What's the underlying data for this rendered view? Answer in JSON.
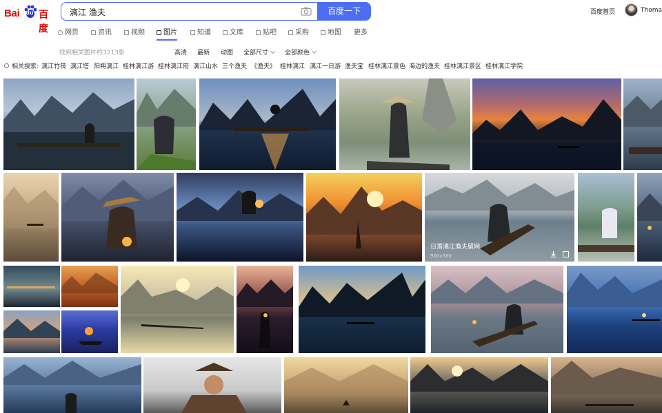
{
  "header": {
    "logo_left": "Bai",
    "logo_mid": "du",
    "logo_right": "百度",
    "search_query": "漓江 渔夫",
    "search_button": "百度一下",
    "home_link": "百度首页",
    "user_name": "Thomas"
  },
  "tabs": [
    {
      "label": "网页",
      "icon": "search-icon"
    },
    {
      "label": "资讯",
      "icon": "news-icon"
    },
    {
      "label": "视频",
      "icon": "video-icon"
    },
    {
      "label": "图片",
      "icon": "image-icon",
      "active": true
    },
    {
      "label": "知道",
      "icon": "question-icon"
    },
    {
      "label": "文库",
      "icon": "document-icon"
    },
    {
      "label": "贴吧",
      "icon": "forum-icon"
    },
    {
      "label": "采购",
      "icon": "shopping-icon"
    },
    {
      "label": "地图",
      "icon": "map-icon"
    },
    {
      "label": "更多",
      "icon": ""
    }
  ],
  "filters": {
    "count_text": "找到相关图片约3213张",
    "items": [
      "高清",
      "最新",
      "动图",
      "全部尺寸",
      "全部颜色"
    ]
  },
  "related": {
    "label": "相关搜索:",
    "items": [
      "漓江竹筏",
      "漓江塔",
      "阳朔漓江",
      "桂林漓江游",
      "桂林漓江府",
      "漓江山水",
      "三个渔夫",
      "《渔夫》",
      "桂林漓江",
      "漓江一日游",
      "渔夫宝",
      "桂林漓江景色",
      "海边的渔夫",
      "桂林漓江景区",
      "桂林漓江学院"
    ]
  },
  "hover_card": {
    "caption": "日落漓江渔夫留网",
    "size": "900x560"
  },
  "colors": {
    "accent": "#4e6ef2",
    "brand_red": "#e10601"
  }
}
